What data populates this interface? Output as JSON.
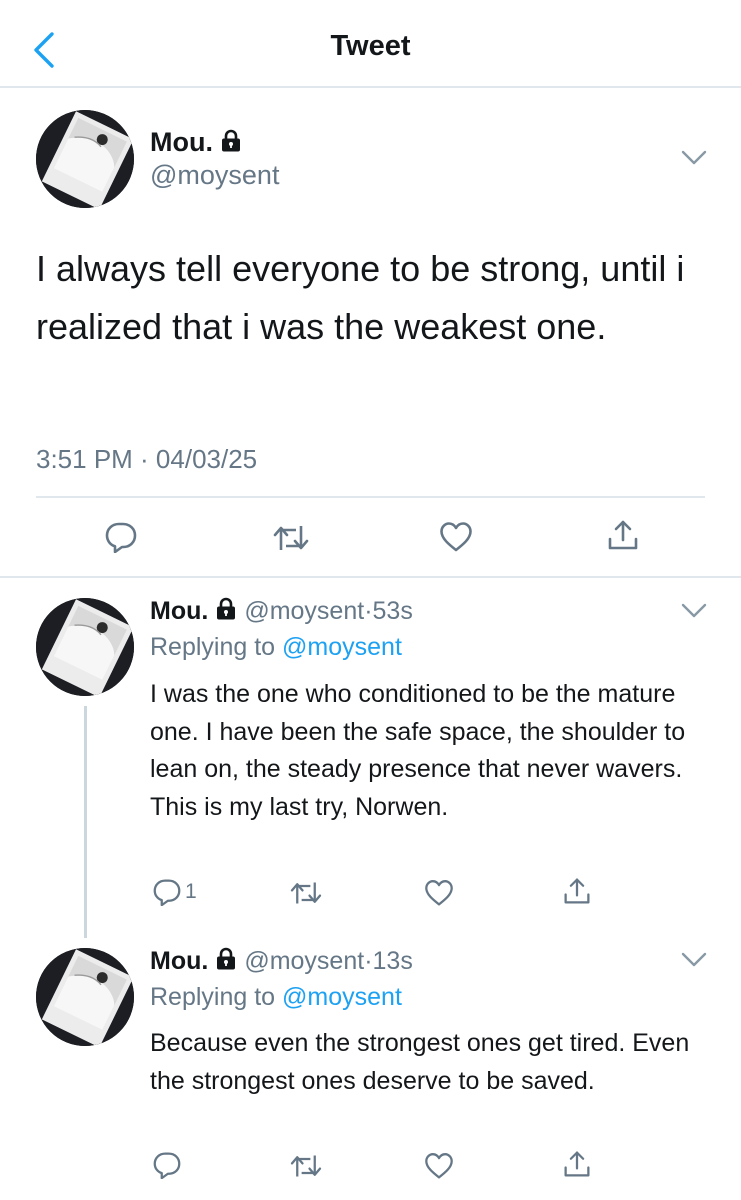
{
  "header": {
    "title": "Tweet",
    "back_icon": "chevron-left-icon"
  },
  "tweet": {
    "name": "Mou.",
    "handle": "@moysent",
    "text": "I always tell everyone to be strong, until i realized that i was the weakest one.",
    "timestamp": "3:51 PM · 04/03/25"
  },
  "replies": [
    {
      "name": "Mou.",
      "handle": "@moysent",
      "time": "53s",
      "replying_prefix": "Replying to ",
      "replying_to": "@moysent",
      "text": "I was the one who conditioned to be the mature one. I have been the safe space, the shoulder to lean on, the steady presence that never wavers. This is my last try, Norwen.",
      "reply_count": "1"
    },
    {
      "name": "Mou.",
      "handle": "@moysent",
      "time": "13s",
      "replying_prefix": "Replying to ",
      "replying_to": "@moysent",
      "text": "Because even the strongest ones get tired. Even the strongest ones deserve to be saved.",
      "reply_count": ""
    }
  ],
  "colors": {
    "accent": "#1da1f2",
    "secondary": "#657786",
    "divider": "#e1e8ed",
    "text": "#14171a"
  },
  "icons": [
    "chevron-left-icon",
    "lock-icon",
    "chevron-down-icon",
    "reply-icon",
    "retweet-icon",
    "like-icon",
    "share-icon"
  ]
}
